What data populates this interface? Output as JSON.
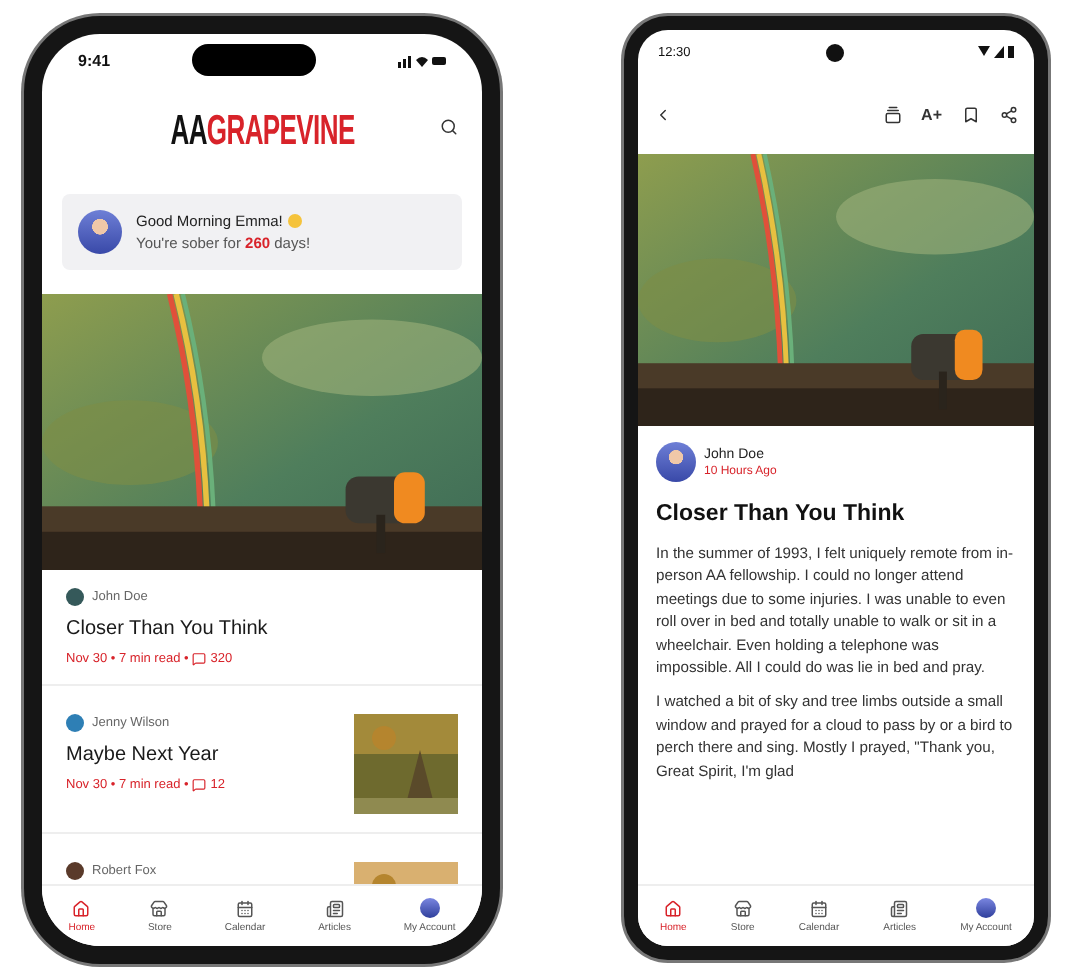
{
  "phones": [
    {
      "kind": "feed",
      "status_bar": {
        "time": "9:41"
      },
      "logo": {
        "prefix": "AA",
        "name": "GRAPEVINE"
      },
      "greeting": {
        "title": "Good Morning Emma!",
        "subtitle": "You're sober for **260** days!"
      },
      "articles": [
        {
          "author": "John Doe",
          "title": "Closer Than You Think",
          "meta": "Nov 30 • 7 min read •",
          "comments": "320",
          "thumbnail": false
        },
        {
          "author": "Jenny Wilson",
          "title": "Maybe Next Year",
          "meta": "Nov 30 • 7 min read •",
          "comments": "12",
          "thumbnail": true
        },
        {
          "author": "Robert Fox",
          "thumbnail": true
        }
      ],
      "tabs": [
        {
          "label": "Home",
          "kind": "home",
          "selected": true
        },
        {
          "label": "Store",
          "kind": "store",
          "selected": false
        },
        {
          "label": "Calendar",
          "kind": "calendar",
          "selected": false
        },
        {
          "label": "Articles",
          "kind": "articles",
          "selected": false
        },
        {
          "label": "My Account",
          "kind": "account",
          "selected": false
        }
      ]
    },
    {
      "kind": "article",
      "status_bar": {
        "time": "12:30"
      },
      "toolbar": {
        "font_button": "A+"
      },
      "author": {
        "name": "John Doe",
        "time": "10 Hours Ago"
      },
      "title": "Closer Than You Think",
      "paragraphs": [
        "In the summer of 1993, I felt uniquely remote from in-person AA fellowship. I could no longer attend meetings due to some injuries. I was unable to even roll over in bed and totally unable to walk or sit in a wheelchair. Even holding a telephone was impossible. All I could do was lie in bed and pray.",
        "I watched a bit of sky and tree limbs outside a small window and prayed for a cloud to pass by or a bird to perch there and sing. Mostly I prayed, \"Thank you, Great Spirit, I'm glad"
      ],
      "tabs": [
        {
          "label": "Home",
          "kind": "home",
          "selected": true
        },
        {
          "label": "Store",
          "kind": "store",
          "selected": false
        },
        {
          "label": "Calendar",
          "kind": "calendar",
          "selected": false
        },
        {
          "label": "Articles",
          "kind": "articles",
          "selected": false
        },
        {
          "label": "My Account",
          "kind": "account",
          "selected": false
        }
      ]
    }
  ]
}
